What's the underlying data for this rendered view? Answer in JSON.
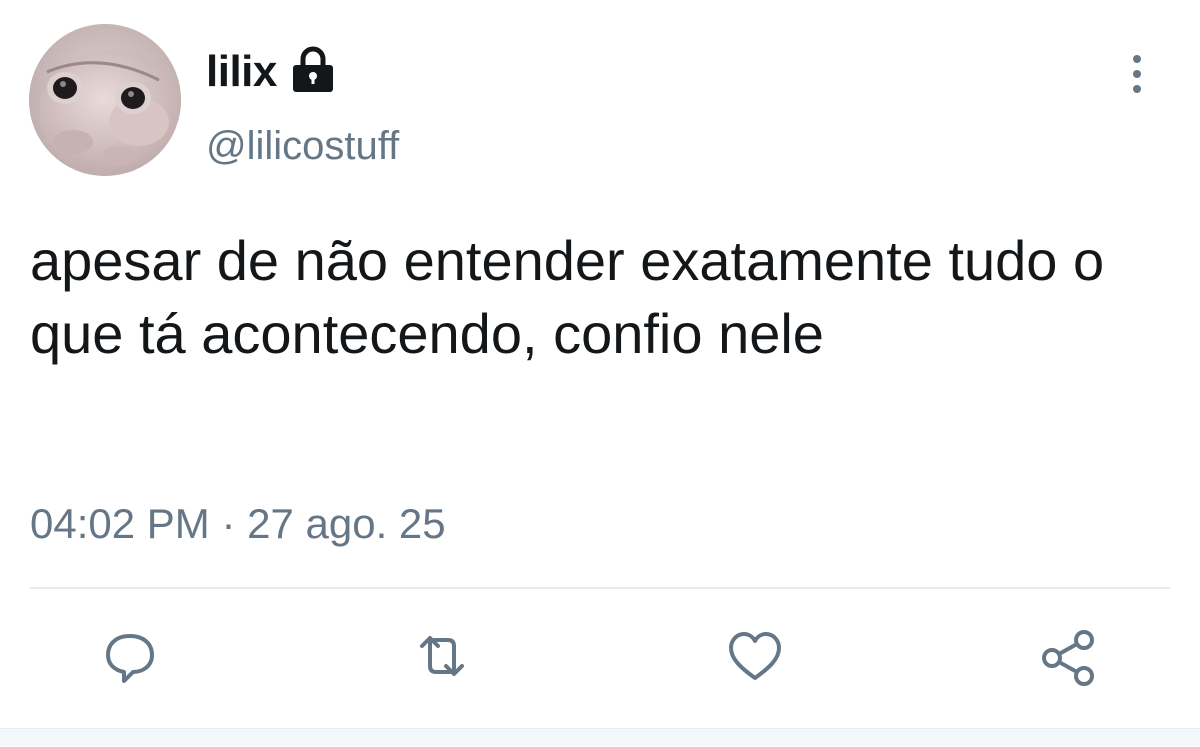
{
  "tweet": {
    "display_name": "lilix",
    "handle": "@lilicostuff",
    "text": "apesar de não entender exatamente tudo o que tá acontecendo, confio nele",
    "time": "04:02 PM",
    "separator": "·",
    "date": "27 ago. 25"
  },
  "icons": {
    "lock": "lock-icon",
    "more": "more-vertical-icon",
    "reply": "reply-icon",
    "retweet": "retweet-icon",
    "like": "heart-icon",
    "share": "share-icon"
  },
  "colors": {
    "text_primary": "#14171a",
    "text_secondary": "#657786",
    "icon_gray": "#657786",
    "divider": "#e6ecf0"
  }
}
